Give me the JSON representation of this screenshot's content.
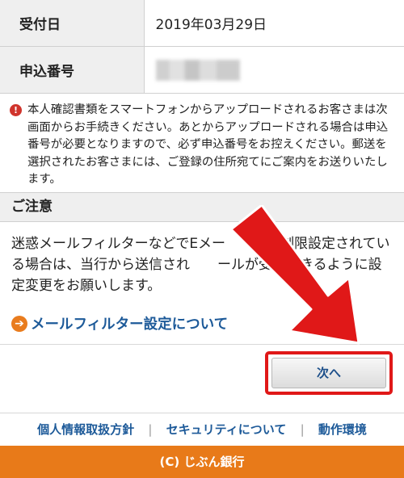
{
  "info_table": {
    "rows": [
      {
        "label": "受付日",
        "value": "2019年03月29日"
      },
      {
        "label": "申込番号",
        "value": ""
      }
    ]
  },
  "notice": {
    "icon": "exclamation-icon",
    "text": "本人確認書類をスマートフォンからアップロードされるお客さまは次画面からお手続きください。あとからアップロードされる場合は申込番号が必要となりますので、必ず申込番号をお控えください。郵送を選択されたお客さまには、ご登録の住所宛てにご案内をお送りいたします。"
  },
  "caution": {
    "heading": "ご注意",
    "body": "迷惑メールフィルターなどでEメー　　信を制限設定されている場合は、当行から送信され　　ールが受信できるように設定変更をお願いします。"
  },
  "filter_link": {
    "label": "メールフィルター設定について",
    "icon": "arrow-right-circle-icon"
  },
  "next_button": {
    "label": "次へ"
  },
  "footer": {
    "links": [
      "個人情報取扱方針",
      "セキュリティについて",
      "動作環境"
    ],
    "separator": "|",
    "copyright": "(C) じぶん銀行"
  },
  "colors": {
    "accent_orange": "#e87a19",
    "link_blue": "#1d5a99",
    "highlight_red": "#e01818"
  }
}
